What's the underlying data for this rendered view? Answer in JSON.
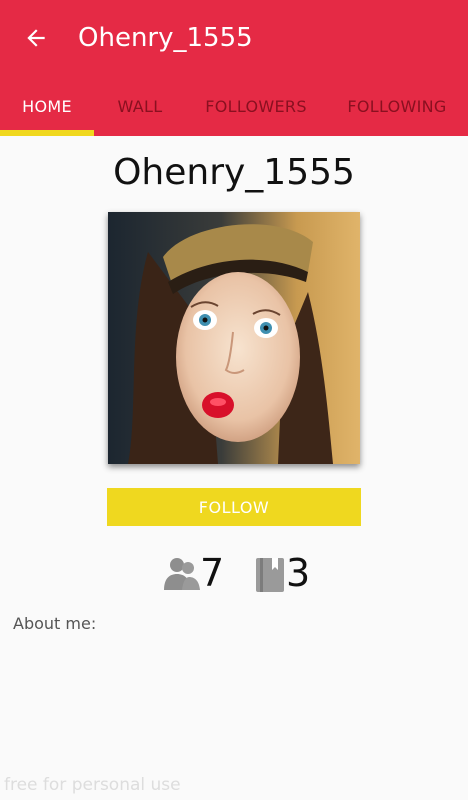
{
  "appbar": {
    "title": "Ohenry_1555"
  },
  "tabs": [
    {
      "label": "HOME",
      "active": true
    },
    {
      "label": "WALL",
      "active": false
    },
    {
      "label": "FOLLOWERS",
      "active": false
    },
    {
      "label": "FOLLOWING",
      "active": false
    }
  ],
  "profile": {
    "username": "Ohenry_1555",
    "follow_label": "FOLLOW",
    "followers_count": "7",
    "posts_count": "3",
    "about_label": "About me:"
  },
  "watermark": "free for personal use",
  "icons": {
    "back": "arrow-left-icon",
    "followers": "people-icon",
    "posts": "book-icon"
  },
  "colors": {
    "primary": "#e52a45",
    "accent": "#efd81f",
    "tab_inactive": "#8a1020"
  }
}
